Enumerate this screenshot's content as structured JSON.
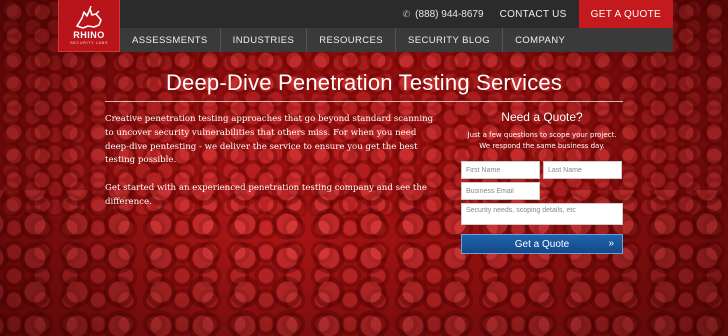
{
  "header": {
    "brand": "RHINO",
    "brand_sub": "SECURITY LABS",
    "phone": "(888) 944-8679",
    "contact": "CONTACT US",
    "quote": "GET A QUOTE"
  },
  "nav": [
    {
      "label": "ASSESSMENTS"
    },
    {
      "label": "INDUSTRIES"
    },
    {
      "label": "RESOURCES"
    },
    {
      "label": "SECURITY BLOG"
    },
    {
      "label": "COMPANY"
    }
  ],
  "hero": {
    "title": "Deep-Dive Penetration Testing Services",
    "paragraph1": "Creative penetration testing approaches that go beyond standard scanning to uncover security vulnerabilities that others miss. For when you need deep-dive pentesting - we deliver the service to ensure you get the best testing possible.",
    "paragraph2": "Get started with an experienced penetration testing company and see the difference."
  },
  "form": {
    "title": "Need a Quote?",
    "subtitle_line1": "Just a few questions to scope your project.",
    "subtitle_line2": "We respond the same business day.",
    "first_name_placeholder": "First Name",
    "last_name_placeholder": "Last Name",
    "email_placeholder": "Business Email",
    "needs_placeholder": "Security needs, scoping details, etc",
    "submit": "Get a Quote"
  },
  "colors": {
    "brand_red": "#c41a1d",
    "topbar": "#2b2b2b",
    "navbar": "#3a3a3a",
    "button_blue": "#1a58a0"
  }
}
